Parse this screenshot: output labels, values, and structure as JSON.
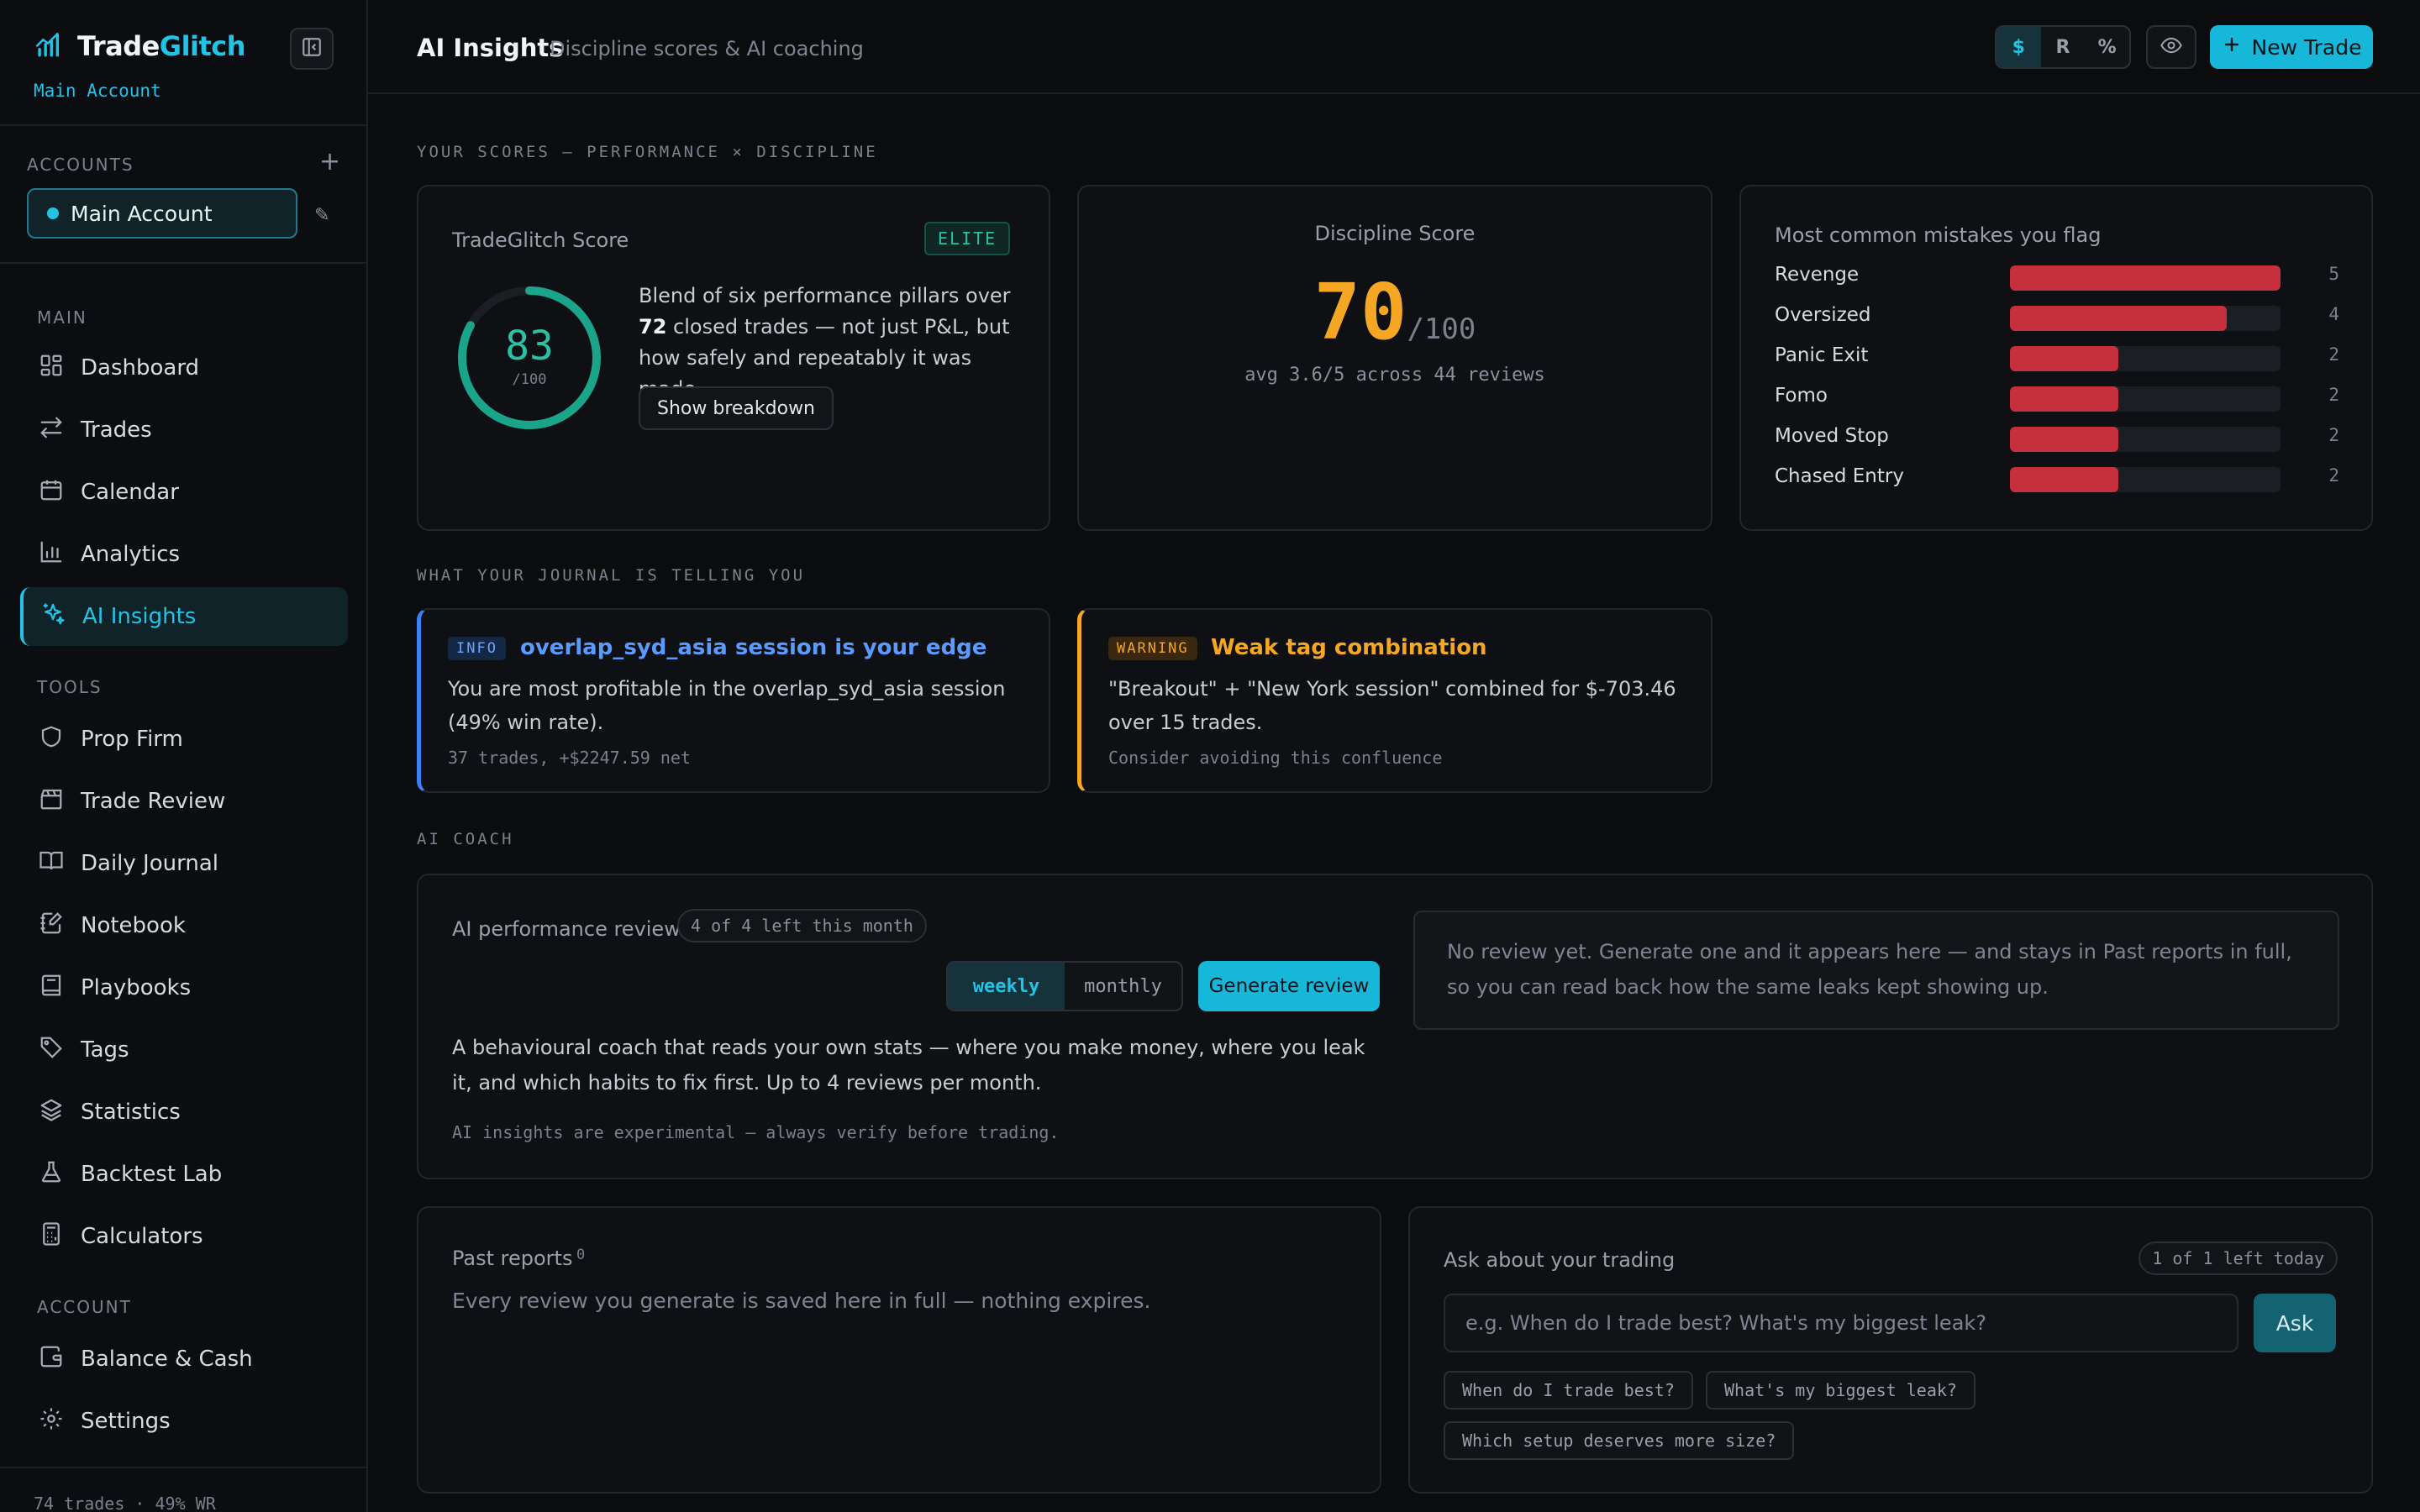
{
  "brand": {
    "name_prefix": "Trade",
    "name_accent": "Glitch",
    "account_sub": "Main Account"
  },
  "colors": {
    "accent": "#22c3e6",
    "score": "#2bc0a3",
    "discipline": "#f5a623",
    "mistake": "#c5303c",
    "info": "#3b82f6",
    "warning": "#f5a623"
  },
  "sidebar": {
    "accounts_label": "ACCOUNTS",
    "active_account": "Main Account",
    "main_label": "MAIN",
    "main_items": [
      {
        "label": "Dashboard",
        "icon": "grid-icon"
      },
      {
        "label": "Trades",
        "icon": "swap-icon"
      },
      {
        "label": "Calendar",
        "icon": "calendar-icon"
      },
      {
        "label": "Analytics",
        "icon": "bar-chart-icon"
      },
      {
        "label": "AI Insights",
        "icon": "sparkles-icon",
        "active": true
      }
    ],
    "tools_label": "TOOLS",
    "tools_items": [
      {
        "label": "Prop Firm",
        "icon": "shield-icon"
      },
      {
        "label": "Trade Review",
        "icon": "clapperboard-icon"
      },
      {
        "label": "Daily Journal",
        "icon": "book-open-icon"
      },
      {
        "label": "Notebook",
        "icon": "notebook-pen-icon"
      },
      {
        "label": "Playbooks",
        "icon": "book-icon"
      },
      {
        "label": "Tags",
        "icon": "tag-icon"
      },
      {
        "label": "Statistics",
        "icon": "layers-icon"
      },
      {
        "label": "Backtest Lab",
        "icon": "flask-icon"
      },
      {
        "label": "Calculators",
        "icon": "calculator-icon"
      }
    ],
    "account_label": "ACCOUNT",
    "account_items": [
      {
        "label": "Balance & Cash",
        "icon": "wallet-icon"
      },
      {
        "label": "Settings",
        "icon": "gear-icon"
      }
    ],
    "footer": "74 trades · 49% WR"
  },
  "header": {
    "title": "AI Insights",
    "subtitle": "Discipline scores & AI coaching",
    "units": [
      "$",
      "R",
      "%"
    ],
    "unit_selected": "$",
    "new_trade": "New Trade"
  },
  "scores": {
    "section_label": "YOUR SCORES — PERFORMANCE × DISCIPLINE",
    "tradeglitch": {
      "title": "TradeGlitch Score",
      "badge": "ELITE",
      "value": 83,
      "value_text": "83",
      "max_text": "/100",
      "desc_pre": "Blend of six performance pillars over ",
      "desc_count": "72",
      "desc_post": " closed trades — not just P&L, but how safely and repeatably it was made.",
      "button": "Show breakdown"
    },
    "discipline": {
      "title": "Discipline Score",
      "value": "70",
      "max": "/100",
      "avg": "avg 3.6/5 across 44 reviews"
    },
    "mistakes": {
      "title": "Most common mistakes you flag",
      "max": 5,
      "items": [
        {
          "label": "Revenge",
          "count": 5
        },
        {
          "label": "Oversized",
          "count": 4
        },
        {
          "label": "Panic Exit",
          "count": 2
        },
        {
          "label": "Fomo",
          "count": 2
        },
        {
          "label": "Moved Stop",
          "count": 2
        },
        {
          "label": "Chased Entry",
          "count": 2
        }
      ]
    }
  },
  "journal": {
    "section_label": "WHAT YOUR JOURNAL IS TELLING YOU",
    "info": {
      "badge": "INFO",
      "title": "overlap_syd_asia session is your edge",
      "body": "You are most profitable in the overlap_syd_asia session (49% win rate).",
      "foot": "37 trades, +$2247.59 net"
    },
    "warning": {
      "badge": "WARNING",
      "title": "Weak tag combination",
      "body": "\"Breakout\" + \"New York session\" combined for $-703.46 over 15 trades.",
      "foot": "Consider avoiding this confluence"
    }
  },
  "coach": {
    "section_label": "AI COACH",
    "title": "AI performance review",
    "quota": "4 of 4 left this month",
    "periods": [
      "weekly",
      "monthly"
    ],
    "period_selected": "weekly",
    "generate": "Generate review",
    "desc": "A behavioural coach that reads your own stats — where you make money, where you leak it, and which habits to fix first. Up to 4 reviews per month.",
    "note": "AI insights are experimental — always verify before trading.",
    "empty": "No review yet. Generate one and it appears here — and stays in Past reports in full, so you can read back how the same leaks kept showing up."
  },
  "past": {
    "title": "Past reports",
    "count": "0",
    "empty": "Every review you generate is saved here in full — nothing expires."
  },
  "ask": {
    "title": "Ask about your trading",
    "quota": "1 of 1 left today",
    "placeholder": "e.g. When do I trade best? What's my biggest leak?",
    "button": "Ask",
    "suggestions": [
      "When do I trade best?",
      "What's my biggest leak?",
      "Which setup deserves more size?"
    ]
  }
}
